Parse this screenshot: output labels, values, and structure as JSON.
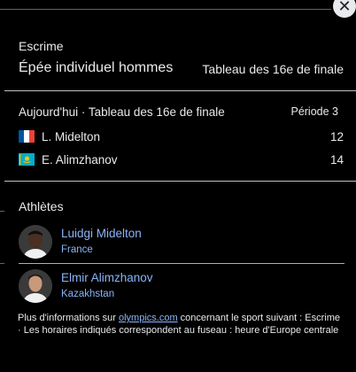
{
  "header": {
    "sport": "Escrime",
    "event": "Épée individuel hommes",
    "round": "Tableau des 16e de finale"
  },
  "match": {
    "date_label": "Aujourd'hui · Tableau des 16e de finale",
    "period": "Période 3",
    "competitors": [
      {
        "name": "L. Midelton",
        "score": "12",
        "flag": "france-flag-icon"
      },
      {
        "name": "E. Alimzhanov",
        "score": "14",
        "flag": "kazakhstan-flag-icon"
      }
    ]
  },
  "athletes": {
    "title": "Athlètes",
    "list": [
      {
        "name": "Luidgi Midelton",
        "country": "France"
      },
      {
        "name": "Elmir Alimzhanov",
        "country": "Kazakhstan"
      }
    ]
  },
  "info": {
    "prefix": "Plus d'informations sur ",
    "link": "olympics.com",
    "suffix": " concernant le sport suivant : Escrime",
    "timezone": "· Les horaires indiqués correspondent au fuseau : heure d'Europe centrale"
  },
  "colors": {
    "background": "#000000",
    "text": "#e8eaed",
    "link": "#8ab4f8"
  }
}
